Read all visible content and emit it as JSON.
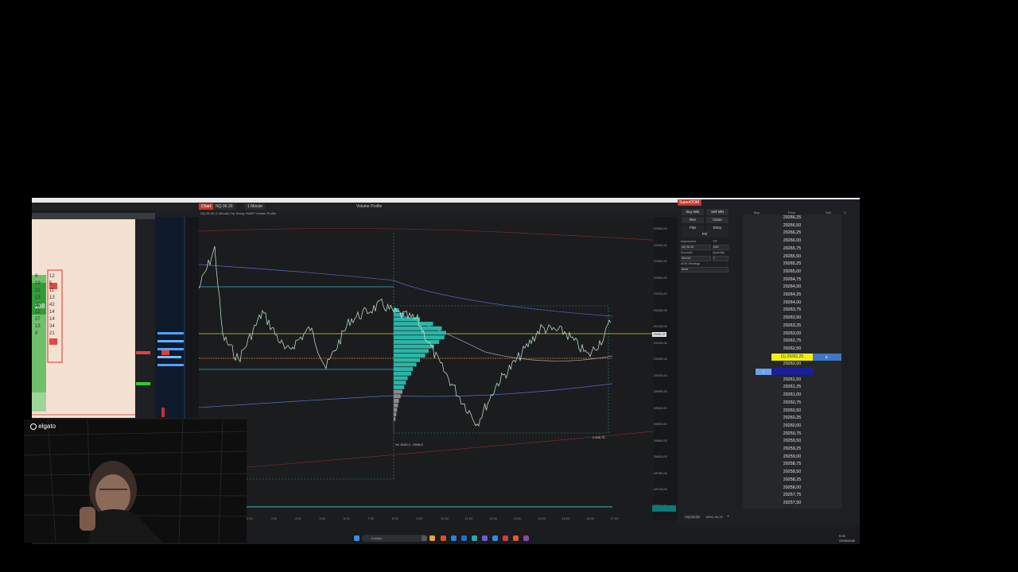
{
  "platform_tabs": {
    "chart_tab": "Chart",
    "instrument": "NQ 06-26",
    "timeframe": "1 Minute",
    "indicator": "Volume Profile"
  },
  "chart": {
    "header_info": "NQ 06-26 (1 Minute) Trp Swing VWAP Volume Profile",
    "price_labels": [
      "29380,00",
      "29340,00",
      "29300,00",
      "29260,00",
      "29220,00",
      "29180,00",
      "29140,00",
      "29100,00",
      "29060,00",
      "29020,00",
      "28980,00",
      "28940,00",
      "28900,00",
      "28860,00",
      "28820,00",
      "28780,00",
      "28740,00",
      "28700,00"
    ],
    "current_price_tag": "29262,25",
    "time_labels": [
      "2:00",
      "3:00",
      "4:00",
      "5:00",
      "6:00",
      "7:00",
      "8:00",
      "9:00",
      "10:00",
      "11:00",
      "12:00",
      "13:00",
      "14:00",
      "15:00",
      "16:00",
      "17:00"
    ],
    "profile_label_1": "2.836,75",
    "profile_label_2": "VA: 29281,0 - 29060,0"
  },
  "superdom": {
    "title": "SuperDOM",
    "buy_mkt": "Buy Mkt",
    "sell_mkt": "Sell Mkt",
    "rev": "Rev",
    "close": "Close",
    "flat": "Flat",
    "entry": "Entry",
    "pnl": "Pnl",
    "instrument_label": "Instrument",
    "tif_label": "TIF",
    "instrument_value": "NQ 06-26",
    "tif_value": "DAY",
    "account_label": "Account",
    "quantity_label": "Quantity",
    "account_value": "Sim101",
    "quantity_value": "1",
    "atm_label": "ATM Strategy",
    "atm_value": "None",
    "col_buy": "Buy",
    "col_price": "Price",
    "col_sell": "Sell",
    "col_c": "C",
    "prices": [
      "29266,25",
      "29266,50",
      "29266,25",
      "29266,00",
      "29265,75",
      "29265,50",
      "29265,25",
      "29265,00",
      "29264,75",
      "29264,50",
      "29264,25",
      "29264,00",
      "29263,75",
      "29263,50",
      "29263,25",
      "29263,00",
      "29262,75",
      "29262,50",
      "29262,25",
      "29262,00",
      "29261,75",
      "29261,50",
      "29261,25",
      "29261,00",
      "29260,75",
      "29260,50",
      "29260,25",
      "29260,00",
      "29259,75",
      "29259,50",
      "29259,25",
      "29259,00",
      "29258,75",
      "29258,50",
      "29258,25",
      "29258,00",
      "29257,75",
      "29257,50"
    ],
    "last_row_text": "(1) 29262,25",
    "ask_size": "8",
    "order_mark": "1",
    "bottom_tab_1": "NQ 06-26",
    "bottom_tab_2": "MNQ 06-26"
  },
  "left_panel": {
    "big_number": "138",
    "cells": [
      "8",
      "12",
      "19",
      "5",
      "22",
      "11",
      "13",
      "13",
      "10",
      "42",
      "12",
      "14",
      "27",
      "14",
      "13",
      "34",
      "8",
      "21"
    ]
  },
  "webcam": {
    "brand": "elgato"
  },
  "taskbar": {
    "search_placeholder": "Zoeken",
    "time": "9:24",
    "date": "20/05/2026"
  }
}
